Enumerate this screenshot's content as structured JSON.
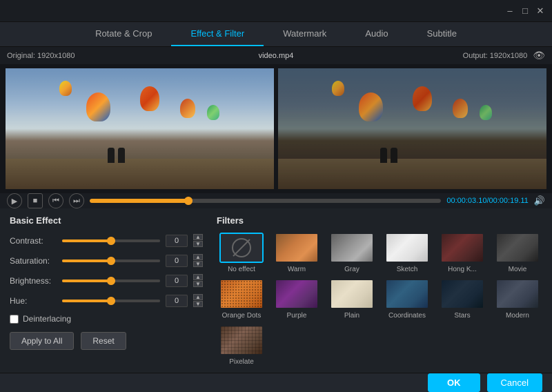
{
  "titleBar": {
    "minimizeLabel": "–",
    "maximizeLabel": "□",
    "closeLabel": "✕"
  },
  "tabs": [
    {
      "id": "rotate-crop",
      "label": "Rotate & Crop",
      "active": false
    },
    {
      "id": "effect-filter",
      "label": "Effect & Filter",
      "active": true
    },
    {
      "id": "watermark",
      "label": "Watermark",
      "active": false
    },
    {
      "id": "audio",
      "label": "Audio",
      "active": false
    },
    {
      "id": "subtitle",
      "label": "Subtitle",
      "active": false
    }
  ],
  "preview": {
    "originalLabel": "Original: 1920x1080",
    "outputLabel": "Output: 1920x1080",
    "filename": "video.mp4",
    "timeDisplay": "00:00:03.10/00:00:19.11",
    "progressPercent": 28
  },
  "basicEffect": {
    "title": "Basic Effect",
    "sliders": [
      {
        "label": "Contrast:",
        "value": "0",
        "percent": 50
      },
      {
        "label": "Saturation:",
        "value": "0",
        "percent": 50
      },
      {
        "label": "Brightness:",
        "value": "0",
        "percent": 50
      },
      {
        "label": "Hue:",
        "value": "0",
        "percent": 50
      }
    ],
    "deinterlaceLabel": "Deinterlacing",
    "applyToAllLabel": "Apply to All",
    "resetLabel": "Reset"
  },
  "filters": {
    "title": "Filters",
    "items": [
      {
        "id": "no-effect",
        "name": "No effect",
        "active": true
      },
      {
        "id": "warm",
        "name": "Warm",
        "active": false
      },
      {
        "id": "gray",
        "name": "Gray",
        "active": false
      },
      {
        "id": "sketch",
        "name": "Sketch",
        "active": false
      },
      {
        "id": "hongkong",
        "name": "Hong K...",
        "active": false
      },
      {
        "id": "movie",
        "name": "Movie",
        "active": false
      },
      {
        "id": "orange-dots",
        "name": "Orange Dots",
        "active": false
      },
      {
        "id": "purple",
        "name": "Purple",
        "active": false
      },
      {
        "id": "plain",
        "name": "Plain",
        "active": false
      },
      {
        "id": "coordinates",
        "name": "Coordinates",
        "active": false
      },
      {
        "id": "stars",
        "name": "Stars",
        "active": false
      },
      {
        "id": "modern",
        "name": "Modern",
        "active": false
      },
      {
        "id": "pixelate",
        "name": "Pixelate",
        "active": false
      }
    ]
  },
  "bottomBar": {
    "okLabel": "OK",
    "cancelLabel": "Cancel"
  }
}
